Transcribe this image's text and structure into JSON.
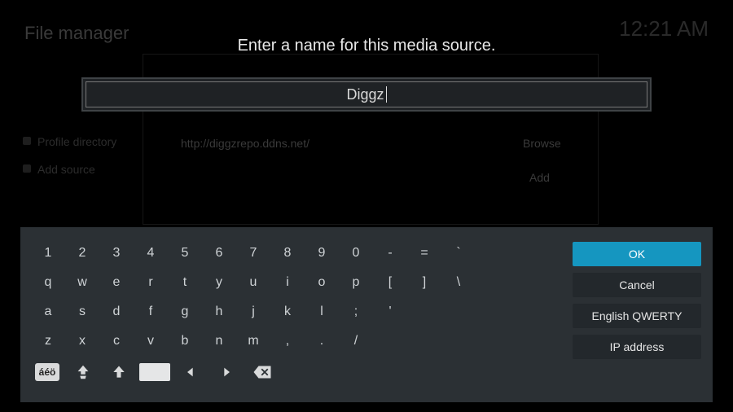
{
  "background": {
    "title": "File manager",
    "clock": "12:21 AM",
    "url": "http://diggzrepo.ddns.net/",
    "browse": "Browse",
    "add": "Add",
    "side1": "Profile directory",
    "side2": "Add source"
  },
  "dialog": {
    "prompt": "Enter a name for this media source.",
    "input_value": "Diggz"
  },
  "keyboard": {
    "row1": [
      "1",
      "2",
      "3",
      "4",
      "5",
      "6",
      "7",
      "8",
      "9",
      "0",
      "-",
      "=",
      "`"
    ],
    "row2": [
      "q",
      "w",
      "e",
      "r",
      "t",
      "y",
      "u",
      "i",
      "o",
      "p",
      "[",
      "]",
      "\\"
    ],
    "row3": [
      "a",
      "s",
      "d",
      "f",
      "g",
      "h",
      "j",
      "k",
      "l",
      ";",
      "'"
    ],
    "row4": [
      "z",
      "x",
      "c",
      "v",
      "b",
      "n",
      "m",
      ",",
      ".",
      "/"
    ],
    "accent_label": "áéö"
  },
  "buttons": {
    "ok": "OK",
    "cancel": "Cancel",
    "layout": "English QWERTY",
    "ip": "IP address"
  }
}
